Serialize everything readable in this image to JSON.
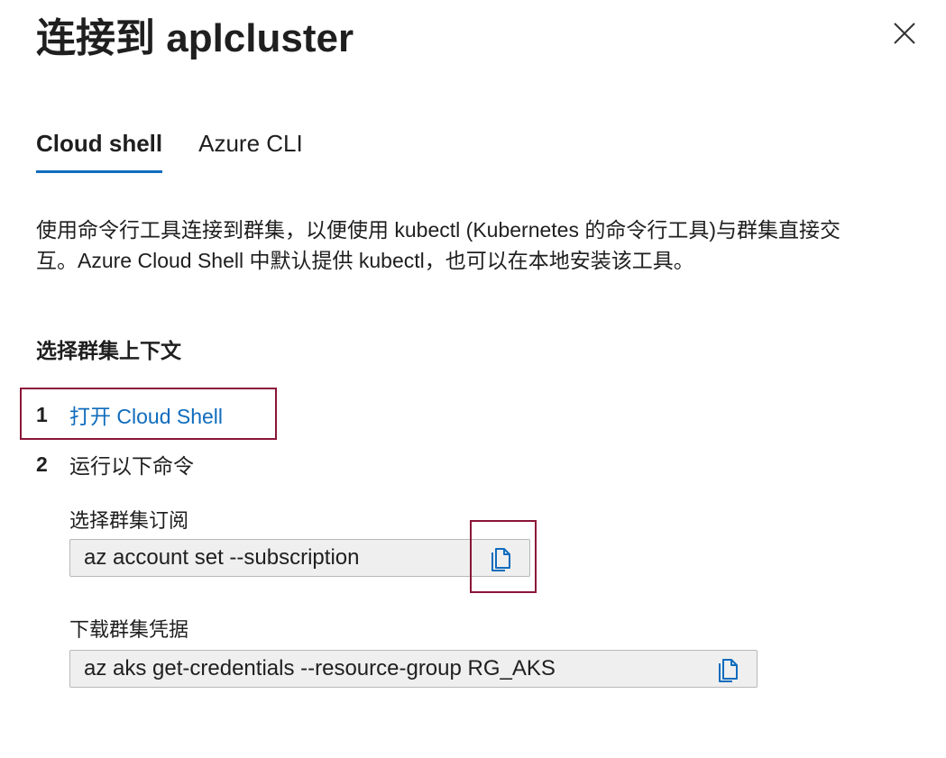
{
  "header": {
    "title": "连接到 aplcluster"
  },
  "tabs": [
    {
      "label": "Cloud shell",
      "active": true
    },
    {
      "label": "Azure CLI",
      "active": false
    }
  ],
  "description": "使用命令行工具连接到群集，以便使用 kubectl (Kubernetes 的命令行工具)与群集直接交互。Azure Cloud Shell 中默认提供 kubectl，也可以在本地安装该工具。",
  "section": {
    "heading": "选择群集上下文"
  },
  "steps": [
    {
      "number": "1",
      "label": "打开 Cloud Shell"
    },
    {
      "number": "2",
      "label": "运行以下命令"
    }
  ],
  "commands": [
    {
      "label": "选择群集订阅",
      "value": "az account set --subscription",
      "icon": "copy-icon"
    },
    {
      "label": "下载群集凭据",
      "value": "az aks get-credentials --resource-group RG_AKS",
      "icon": "copy-icon"
    }
  ],
  "colors": {
    "accent": "#0f6cbd",
    "highlight": "#8a1538",
    "command_bg": "#efefef"
  }
}
